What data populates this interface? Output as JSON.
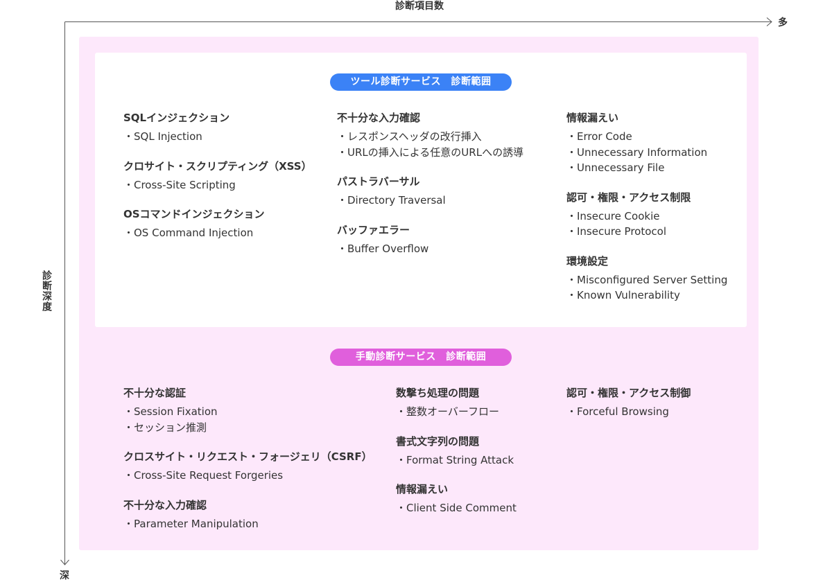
{
  "axis": {
    "x_title": "診断項目数",
    "x_end": "多",
    "y_title": "診断深度",
    "y_end": "深"
  },
  "tool": {
    "label": "ツール診断サービス　診断範囲",
    "columns": [
      [
        {
          "title": "SQLインジェクション",
          "items": [
            "・SQL Injection"
          ]
        },
        {
          "title": "クロサイト・スクリプティング（XSS）",
          "items": [
            "・Cross-Site Scripting"
          ]
        },
        {
          "title": "OSコマンドインジェクション",
          "items": [
            "・OS Command Injection"
          ]
        }
      ],
      [
        {
          "title": "不十分な入力確認",
          "items": [
            "・レスポンスヘッダの改行挿入",
            "・URLの挿入による任意のURLへの誘導"
          ]
        },
        {
          "title": "パストラバーサル",
          "items": [
            "・Directory Traversal"
          ]
        },
        {
          "title": "バッファエラー",
          "items": [
            "・Buffer Overflow"
          ]
        }
      ],
      [
        {
          "title": "情報漏えい",
          "items": [
            "・Error Code",
            "・Unnecessary Information",
            "・Unnecessary File"
          ]
        },
        {
          "title": "認可・権限・アクセス制限",
          "items": [
            "・Insecure Cookie",
            "・Insecure Protocol"
          ]
        },
        {
          "title": "環境設定",
          "items": [
            "・Misconfigured Server Setting",
            "・Known Vulnerability"
          ]
        }
      ]
    ]
  },
  "manual": {
    "label": "手動診断サービス　診断範囲",
    "columns": [
      [
        {
          "title": "不十分な認証",
          "items": [
            "・Session Fixation",
            "・セッション推測"
          ]
        },
        {
          "title": "クロスサイト・リクエスト・フォージェリ（CSRF）",
          "items": [
            "・Cross-Site Request Forgeries"
          ]
        },
        {
          "title": "不十分な入力確認",
          "items": [
            "・Parameter Manipulation"
          ]
        }
      ],
      [
        {
          "title": "数撃ち処理の問題",
          "items": [
            "・整数オーバーフロー"
          ]
        },
        {
          "title": "書式文字列の問題",
          "items": [
            "・Format String Attack"
          ]
        },
        {
          "title": "情報漏えい",
          "items": [
            "・Client Side Comment"
          ]
        }
      ],
      [
        {
          "title": "認可・権限・アクセス制御",
          "items": [
            "・Forceful Browsing"
          ]
        }
      ]
    ]
  }
}
